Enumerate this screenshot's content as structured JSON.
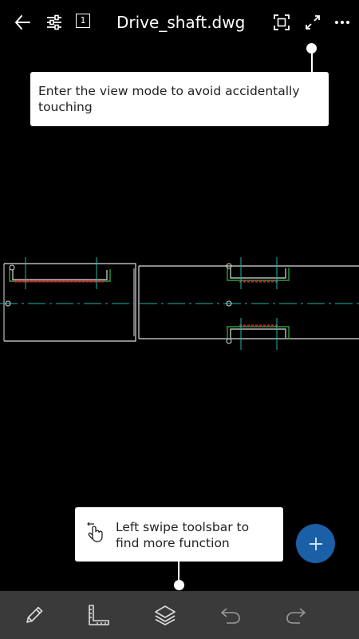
{
  "header": {
    "title": "Drive_shaft.dwg",
    "page_number": "1",
    "icons": {
      "back": "arrow-left-icon",
      "settings": "sliders-icon",
      "page": "page-number-icon",
      "fit": "fit-screen-icon",
      "fullscreen": "expand-icon",
      "more": "more-dots-icon"
    }
  },
  "tooltips": {
    "view_mode": "Enter the view mode to avoid accidentally touching",
    "swipe": "Left swipe toolsbar to find more function"
  },
  "toolbar": {
    "items": [
      {
        "icon": "pencil-icon"
      },
      {
        "icon": "ruler-icon"
      },
      {
        "icon": "layers-icon"
      },
      {
        "icon": "undo-icon"
      },
      {
        "icon": "redo-icon"
      }
    ]
  },
  "fab": {
    "icon": "plus-icon"
  },
  "colors": {
    "background": "#000000",
    "toolbar": "#3a3a3a",
    "fab": "#1b5fa6",
    "centerline": "#1fb5a8",
    "hatch": "#c03030",
    "keyway": "#2f9e3a"
  }
}
